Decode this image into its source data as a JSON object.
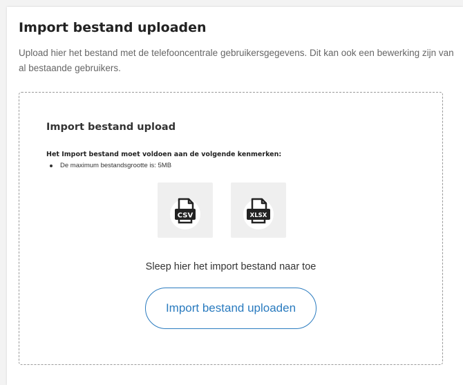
{
  "header": {
    "title": "Import bestand uploaden",
    "description": "Upload hier het bestand met de telefooncentrale gebruikersgegevens. Dit kan ook een bewerking zijn van al bestaande gebruikers."
  },
  "dropzone": {
    "title": "Import bestand upload",
    "requirements_heading": "Het Import bestand moet voldoen aan de volgende kenmerken:",
    "requirements": [
      "De maximum bestandsgrootte is: 5MB"
    ],
    "file_types": [
      {
        "icon": "csv-file-icon",
        "label": "CSV"
      },
      {
        "icon": "xlsx-file-icon",
        "label": "XLSX"
      }
    ],
    "drag_text": "Sleep hier het import bestand naar toe",
    "upload_button": "Import bestand uploaden"
  },
  "colors": {
    "accent": "#2a7bbf",
    "icon_tile": "#efefef",
    "icon_dark": "#222222"
  }
}
